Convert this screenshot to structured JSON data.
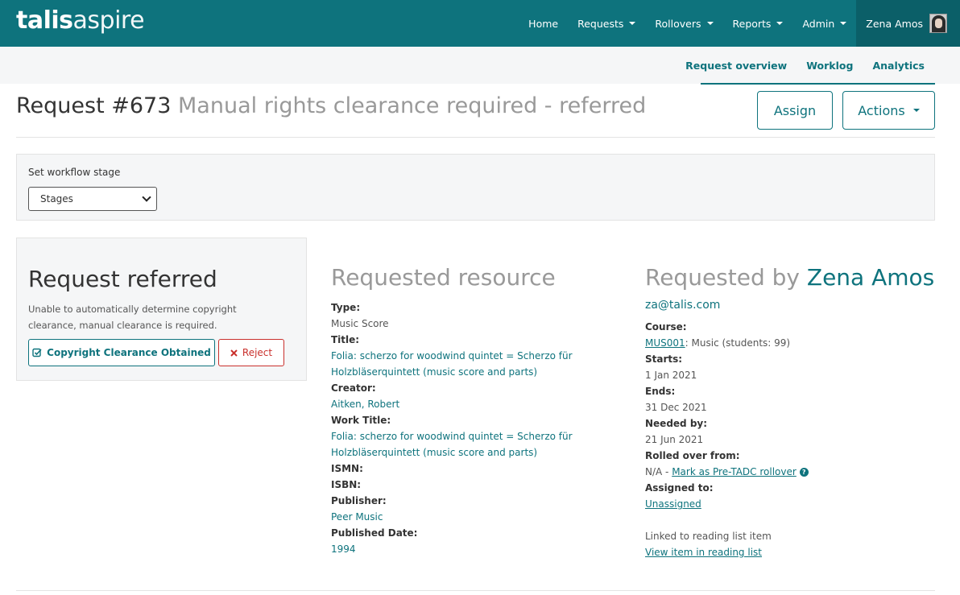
{
  "navbar": {
    "logo_bold": "talis",
    "logo_light": "aspire",
    "items": [
      {
        "label": "Home",
        "dropdown": false
      },
      {
        "label": "Requests",
        "dropdown": true
      },
      {
        "label": "Rollovers",
        "dropdown": true
      },
      {
        "label": "Reports",
        "dropdown": true
      },
      {
        "label": "Admin",
        "dropdown": true
      }
    ],
    "user_name": "Zena Amos"
  },
  "subnav": {
    "items": [
      "Request overview",
      "Worklog",
      "Analytics"
    ],
    "active": "Request overview"
  },
  "header": {
    "title_main": "Request #673",
    "title_status": "Manual rights clearance required - referred",
    "assign_label": "Assign",
    "actions_label": "Actions"
  },
  "workflow": {
    "label": "Set workflow stage",
    "selected": "Stages"
  },
  "referred": {
    "title": "Request referred",
    "text": "Unable to automatically determine copyright clearance, manual clearance is required.",
    "clear_label": "Copyright Clearance Obtained",
    "reject_label": "Reject"
  },
  "resource": {
    "heading": "Requested resource",
    "type_label": "Type:",
    "type_value": "Music Score",
    "title_label": "Title:",
    "title_value_line1": "Folia: scherzo for woodwind quintet = Scherzo für",
    "title_value_line2": "Holzbläserquintett (music score and parts)",
    "creator_label": "Creator:",
    "creator_value": "Aitken, Robert",
    "work_title_label": "Work Title:",
    "work_title_line1": "Folia: scherzo for woodwind quintet = Scherzo für",
    "work_title_line2": "Holzbläserquintett (music score and parts)",
    "ismn_label": "ISMN:",
    "isbn_label": "ISBN:",
    "publisher_label": "Publisher:",
    "publisher_value": "Peer Music",
    "published_date_label": "Published Date:",
    "published_date_value": "1994"
  },
  "requester": {
    "heading_prefix": "Requested by",
    "name": "Zena Amos",
    "email": "za@talis.com",
    "course_label": "Course:",
    "course_code": "MUS001",
    "course_rest": ": Music (students: 99)",
    "starts_label": "Starts:",
    "starts_value": "1 Jan 2021",
    "ends_label": "Ends:",
    "ends_value": "31 Dec 2021",
    "needed_label": "Needed by:",
    "needed_value": "21 Jun 2021",
    "rolled_label": "Rolled over from:",
    "rolled_prefix": "N/A - ",
    "rolled_link": "Mark as Pre-TADC rollover",
    "assigned_label": "Assigned to:",
    "assigned_value": "Unassigned",
    "linked_text": "Linked to reading list item",
    "view_link": "View item in reading list"
  }
}
